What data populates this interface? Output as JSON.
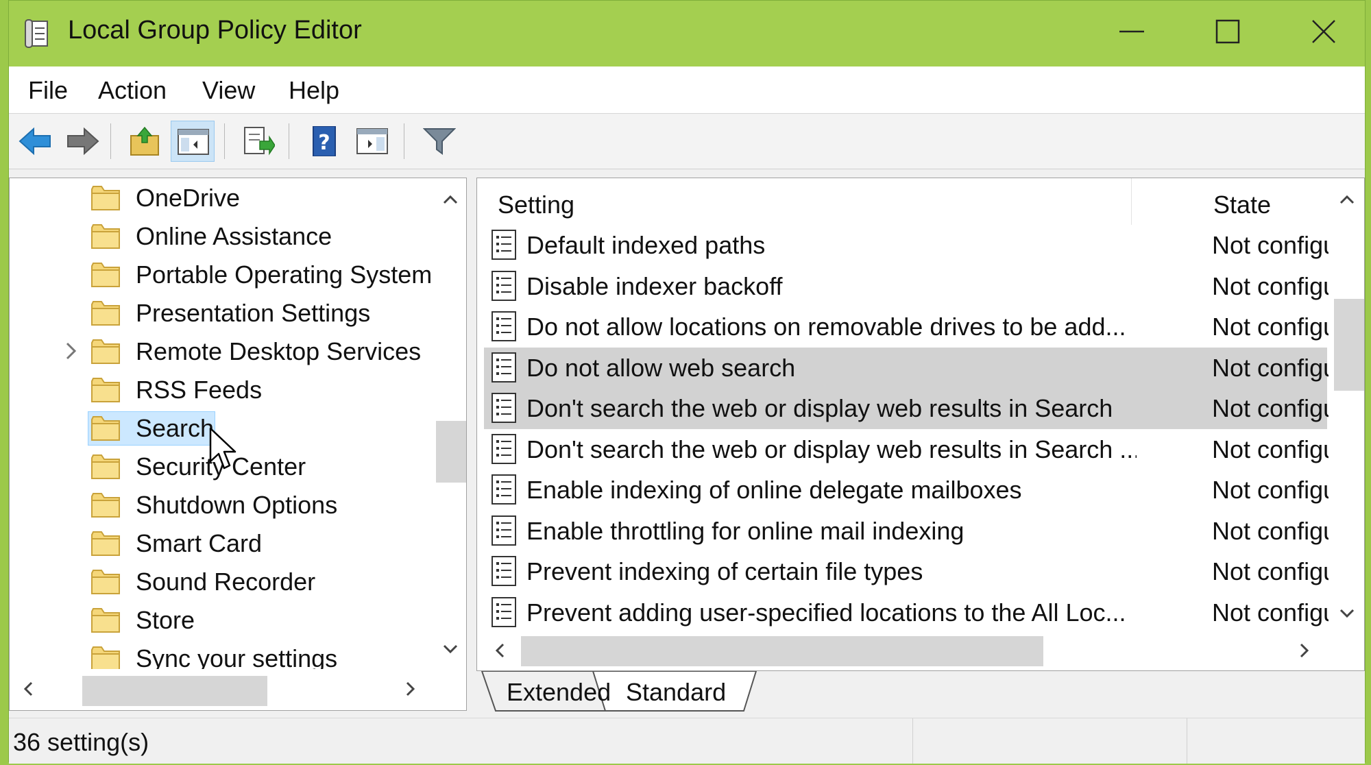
{
  "window": {
    "title": "Local Group Policy Editor"
  },
  "menu": [
    "File",
    "Action",
    "View",
    "Help"
  ],
  "toolbar": {
    "buttons": [
      "back-icon",
      "forward-icon",
      "up-folder-icon",
      "show-hide-tree-icon",
      "export-list-icon",
      "help-icon",
      "action-pane-icon",
      "filter-icon"
    ]
  },
  "tree": {
    "items": [
      {
        "label": "OneDrive"
      },
      {
        "label": "Online Assistance"
      },
      {
        "label": "Portable Operating System"
      },
      {
        "label": "Presentation Settings"
      },
      {
        "label": "Remote Desktop Services"
      },
      {
        "label": "RSS Feeds"
      },
      {
        "label": "Search"
      },
      {
        "label": "Security Center"
      },
      {
        "label": "Shutdown Options"
      },
      {
        "label": "Smart Card"
      },
      {
        "label": "Sound Recorder"
      },
      {
        "label": "Store"
      },
      {
        "label": "Sync your settings"
      }
    ]
  },
  "list": {
    "columns": {
      "setting": "Setting",
      "state": "State"
    },
    "rows": [
      {
        "setting": "Default indexed paths",
        "state": "Not configured"
      },
      {
        "setting": "Disable indexer backoff",
        "state": "Not configured"
      },
      {
        "setting": "Do not allow locations on removable drives to be add...",
        "state": "Not configured"
      },
      {
        "setting": "Do not allow web search",
        "state": "Not configured"
      },
      {
        "setting": "Don't search the web or display web results in Search",
        "state": "Not configured"
      },
      {
        "setting": "Don't search the web or display web results in Search ...",
        "state": "Not configured"
      },
      {
        "setting": "Enable indexing of online delegate mailboxes",
        "state": "Not configured"
      },
      {
        "setting": "Enable throttling for online mail indexing",
        "state": "Not configured"
      },
      {
        "setting": "Prevent indexing of certain file types",
        "state": "Not configured"
      },
      {
        "setting": "Prevent adding user-specified locations to the All Loc...",
        "state": "Not configured"
      }
    ]
  },
  "tabs": [
    "Extended",
    "Standard"
  ],
  "status": {
    "text": "36 setting(s)"
  },
  "colors": {
    "titlebar": "#a4cf50",
    "selection_row": "#d2d2d2",
    "tree_selection": "#cce8ff"
  }
}
